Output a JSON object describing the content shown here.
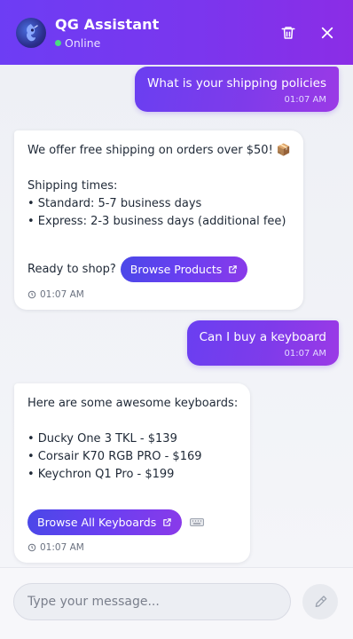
{
  "header": {
    "title": "QG Assistant",
    "status": "Online",
    "avatar_icon": "robot-avatar-icon",
    "delete_icon": "trash-icon",
    "close_icon": "close-icon"
  },
  "messages": [
    {
      "role": "user",
      "text": "What is your shipping policies",
      "time": "01:07 AM"
    },
    {
      "role": "assistant",
      "lines": [
        "We offer free shipping on orders over $50! 📦",
        "",
        "Shipping times:",
        "• Standard: 5-7 business days",
        "• Express: 2-3 business days (additional fee)",
        ""
      ],
      "cta_prefix": "Ready to shop?",
      "cta_label": "Browse Products",
      "time": "01:07 AM"
    },
    {
      "role": "user",
      "text": "Can I buy a keyboard",
      "time": "01:07 AM"
    },
    {
      "role": "assistant",
      "lines": [
        "Here are some awesome keyboards:",
        "",
        "• Ducky One 3 TKL - $139",
        "• Corsair K70 RGB PRO - $169",
        "• Keychron Q1 Pro - $199",
        ""
      ],
      "cta_label": "Browse All Keyboards",
      "cta_suffix_icon": "keyboard-icon",
      "time": "01:07 AM"
    }
  ],
  "composer": {
    "placeholder": "Type your message...",
    "send_icon": "send-icon"
  },
  "colors": {
    "header_gradient_start": "#6d3df4",
    "header_gradient_end": "#8b2de6",
    "status_online": "#4ade80",
    "cta_gradient_start": "#4a48e8",
    "cta_gradient_end": "#8a3ae9"
  }
}
